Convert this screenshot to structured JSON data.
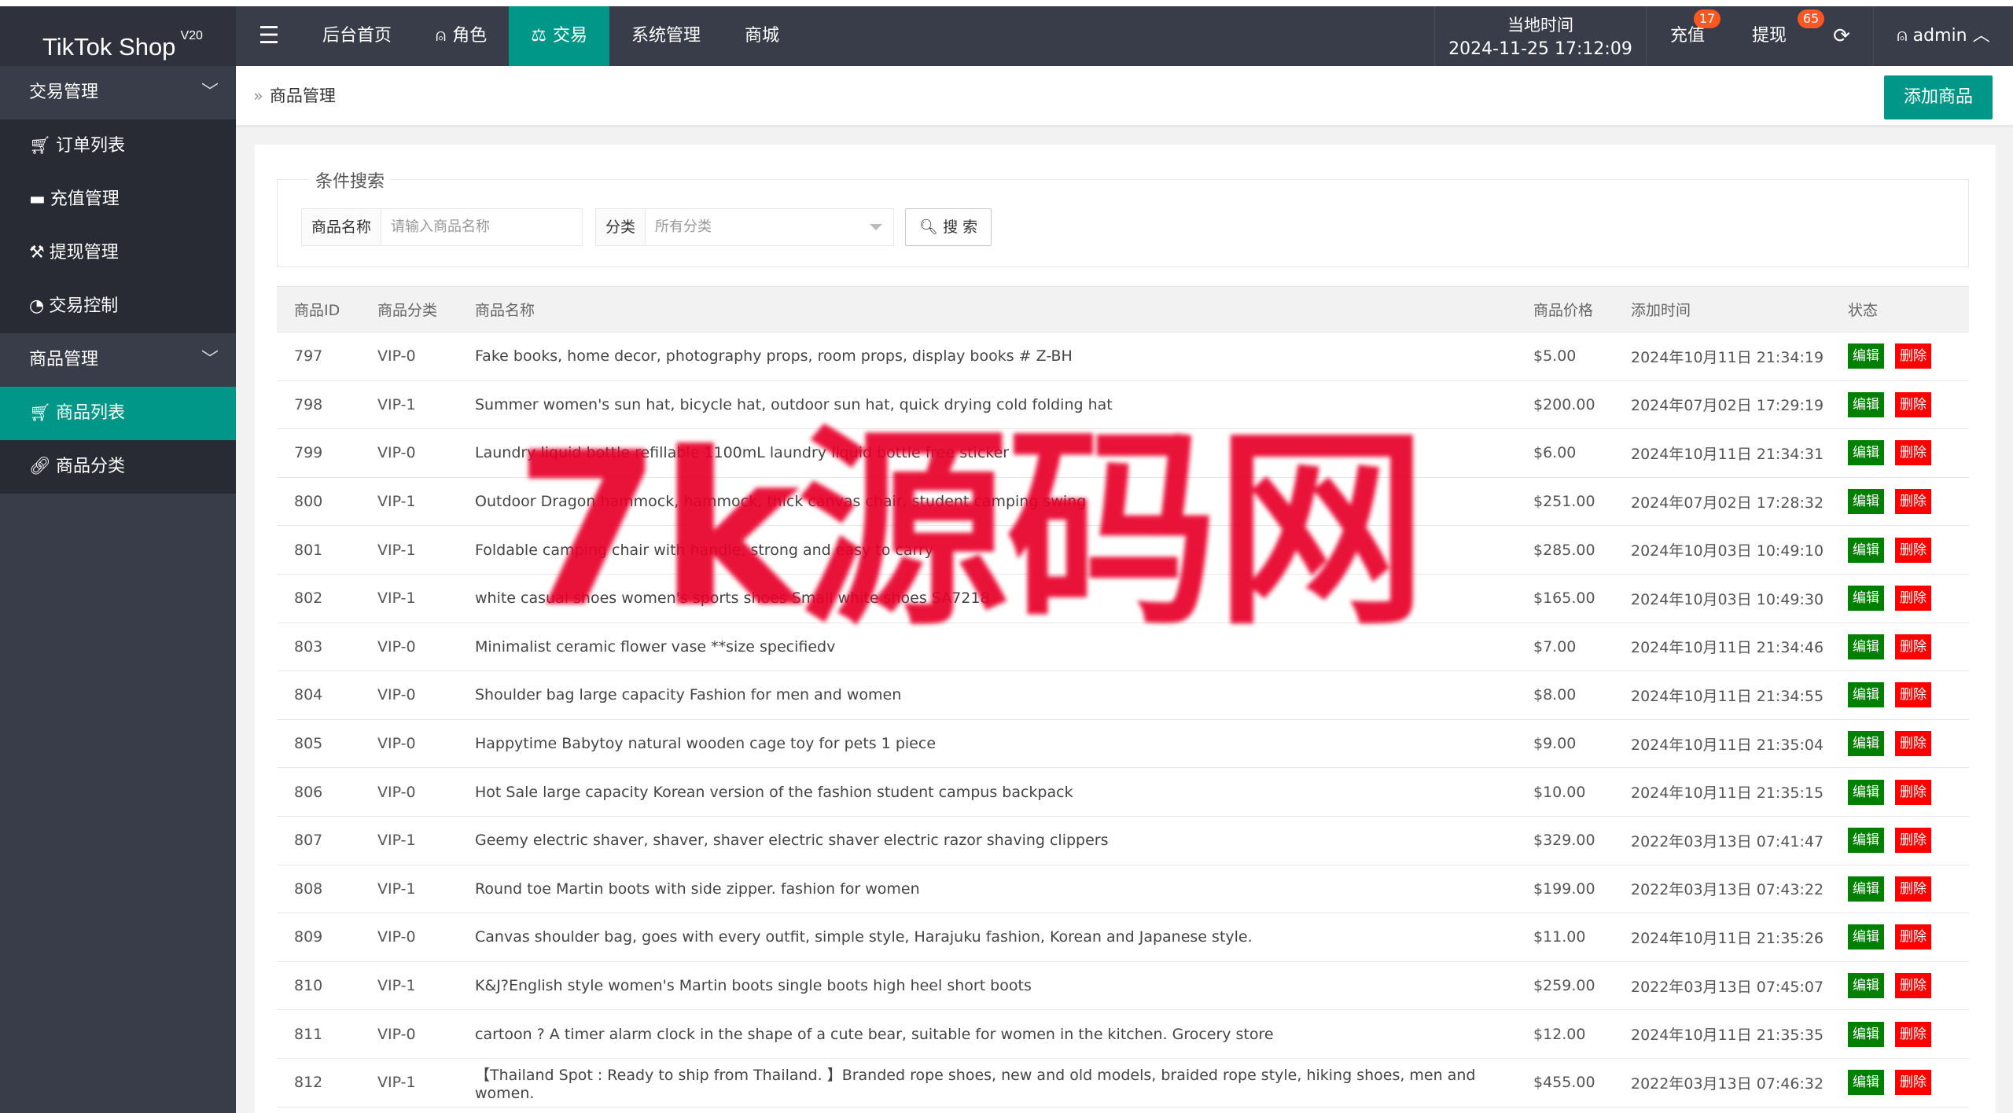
{
  "app": {
    "title": "TikTok Shop",
    "version": "V20"
  },
  "topnav": [
    {
      "label": "后台首页",
      "icon": "",
      "active": false
    },
    {
      "label": "角色",
      "icon": "user-icon",
      "active": false
    },
    {
      "label": "交易",
      "icon": "scale-icon",
      "active": true
    },
    {
      "label": "系统管理",
      "icon": "",
      "active": false
    },
    {
      "label": "商城",
      "icon": "",
      "active": false
    }
  ],
  "header": {
    "time_label": "当地时间",
    "time_value": "2024-11-25 17:12:09",
    "recharge_label": "充值",
    "recharge_badge": "17",
    "withdraw_label": "提现",
    "withdraw_badge": "65",
    "user": "admin"
  },
  "sidebar": {
    "group1": "交易管理",
    "group1_items": [
      "订单列表",
      "充值管理",
      "提现管理",
      "交易控制"
    ],
    "group2": "商品管理",
    "group2_items": [
      "商品列表",
      "商品分类"
    ]
  },
  "breadcrumb": "商品管理",
  "add_button": "添加商品",
  "search": {
    "legend": "条件搜索",
    "name_label": "商品名称",
    "name_placeholder": "请输入商品名称",
    "category_label": "分类",
    "category_value": "所有分类",
    "button": "搜 索"
  },
  "table": {
    "headers": [
      "商品ID",
      "商品分类",
      "商品名称",
      "商品价格",
      "添加时间",
      "状态"
    ],
    "edit_label": "编辑",
    "delete_label": "删除",
    "rows": [
      [
        "797",
        "VIP-0",
        "Fake books, home decor, photography props, room props, display books # Z-BH",
        "$5.00",
        "2024年10月11日 21:34:19"
      ],
      [
        "798",
        "VIP-1",
        "Summer women's sun hat, bicycle hat, outdoor sun hat, quick drying cold folding hat",
        "$200.00",
        "2024年07月02日 17:29:19"
      ],
      [
        "799",
        "VIP-0",
        "Laundry liquid bottle refillable 1100mL laundry liquid bottle free sticker",
        "$6.00",
        "2024年10月11日 21:34:31"
      ],
      [
        "800",
        "VIP-1",
        "Outdoor Dragon hammock, hammock, thick canvas chair, student camping swing",
        "$251.00",
        "2024年07月02日 17:28:32"
      ],
      [
        "801",
        "VIP-1",
        "Foldable camping chair with handle, strong and easy to carry",
        "$285.00",
        "2024年10月03日 10:49:10"
      ],
      [
        "802",
        "VIP-1",
        "white casual shoes women's sports shoes Small white shoes SA7218",
        "$165.00",
        "2024年10月03日 10:49:30"
      ],
      [
        "803",
        "VIP-0",
        "Minimalist ceramic flower vase **size specifiedv",
        "$7.00",
        "2024年10月11日 21:34:46"
      ],
      [
        "804",
        "VIP-0",
        "Shoulder bag large capacity Fashion for men and women",
        "$8.00",
        "2024年10月11日 21:34:55"
      ],
      [
        "805",
        "VIP-0",
        "Happytime Babytoy natural wooden cage toy for pets 1 piece",
        "$9.00",
        "2024年10月11日 21:35:04"
      ],
      [
        "806",
        "VIP-0",
        "Hot Sale large capacity Korean version of the fashion student campus backpack",
        "$10.00",
        "2024年10月11日 21:35:15"
      ],
      [
        "807",
        "VIP-1",
        "Geemy electric shaver, shaver, shaver electric shaver electric razor shaving clippers",
        "$329.00",
        "2022年03月13日 07:41:47"
      ],
      [
        "808",
        "VIP-1",
        "Round toe Martin boots with side zipper. fashion for women",
        "$199.00",
        "2022年03月13日 07:43:22"
      ],
      [
        "809",
        "VIP-0",
        "Canvas shoulder bag, goes with every outfit, simple style, Harajuku fashion, Korean and Japanese style.",
        "$11.00",
        "2024年10月11日 21:35:26"
      ],
      [
        "810",
        "VIP-1",
        "K&J?English style women's Martin boots single boots high heel short boots",
        "$259.00",
        "2022年03月13日 07:45:07"
      ],
      [
        "811",
        "VIP-0",
        "cartoon ? A timer alarm clock in the shape of a cute bear, suitable for women in the kitchen. Grocery store",
        "$12.00",
        "2024年10月11日 21:35:35"
      ],
      [
        "812",
        "VIP-1",
        "【Thailand Spot : Ready to ship from Thailand. 】Branded rope shoes, new and old models, braided rope style, hiking shoes, men and women.",
        "$455.00",
        "2022年03月13日 07:46:32"
      ]
    ]
  },
  "watermark": "7k源码网",
  "colors": {
    "accent": "#009688",
    "header": "#393d49",
    "edit": "#008000",
    "delete": "#ff0000",
    "badge": "#ff5722"
  }
}
